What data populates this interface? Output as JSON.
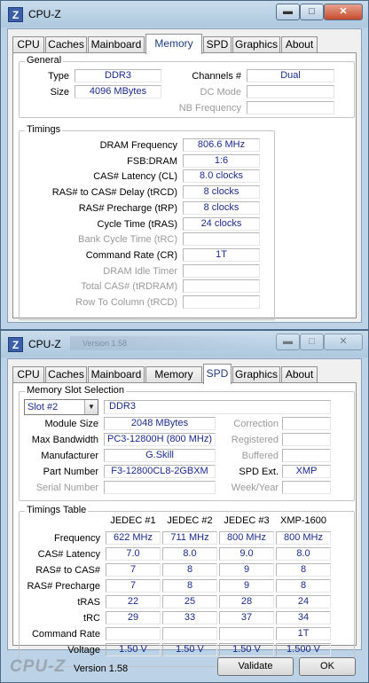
{
  "app_title": "CPU-Z",
  "window2_ghost_title": "Version 1.58",
  "tabs": [
    "CPU",
    "Caches",
    "Mainboard",
    "Memory",
    "SPD",
    "Graphics",
    "About"
  ],
  "memory": {
    "general": {
      "legend": "General",
      "type_label": "Type",
      "type": "DDR3",
      "size_label": "Size",
      "size": "4096 MBytes",
      "channels_label": "Channels #",
      "channels": "Dual",
      "dc_mode_label": "DC Mode",
      "dc_mode": "",
      "nb_freq_label": "NB Frequency",
      "nb_freq": ""
    },
    "timings": {
      "legend": "Timings",
      "rows": [
        {
          "label": "DRAM Frequency",
          "value": "806.6 MHz",
          "enabled": true
        },
        {
          "label": "FSB:DRAM",
          "value": "1:6",
          "enabled": true
        },
        {
          "label": "CAS# Latency (CL)",
          "value": "8.0 clocks",
          "enabled": true
        },
        {
          "label": "RAS# to CAS# Delay (tRCD)",
          "value": "8 clocks",
          "enabled": true
        },
        {
          "label": "RAS# Precharge (tRP)",
          "value": "8 clocks",
          "enabled": true
        },
        {
          "label": "Cycle Time (tRAS)",
          "value": "24 clocks",
          "enabled": true
        },
        {
          "label": "Bank Cycle Time (tRC)",
          "value": "",
          "enabled": false
        },
        {
          "label": "Command Rate (CR)",
          "value": "1T",
          "enabled": true
        },
        {
          "label": "DRAM Idle Timer",
          "value": "",
          "enabled": false
        },
        {
          "label": "Total CAS# (tRDRAM)",
          "value": "",
          "enabled": false
        },
        {
          "label": "Row To Column (tRCD)",
          "value": "",
          "enabled": false
        }
      ]
    }
  },
  "spd": {
    "slot": {
      "legend": "Memory Slot Selection",
      "selected_slot": "Slot #2",
      "type": "DDR3",
      "module_size_label": "Module Size",
      "module_size": "2048 MBytes",
      "max_bw_label": "Max Bandwidth",
      "max_bw": "PC3-12800H (800 MHz)",
      "manufacturer_label": "Manufacturer",
      "manufacturer": "G.Skill",
      "part_label": "Part Number",
      "part": "F3-12800CL8-2GBXM",
      "serial_label": "Serial Number",
      "serial": "",
      "correction_label": "Correction",
      "correction": "",
      "registered_label": "Registered",
      "registered": "",
      "buffered_label": "Buffered",
      "buffered": "",
      "spd_ext_label": "SPD Ext.",
      "spd_ext": "XMP",
      "week_year_label": "Week/Year",
      "week_year": ""
    },
    "timings_table": {
      "legend": "Timings Table",
      "columns": [
        "JEDEC #1",
        "JEDEC #2",
        "JEDEC #3",
        "XMP-1600"
      ],
      "rows": [
        {
          "label": "Frequency",
          "values": [
            "622 MHz",
            "711 MHz",
            "800 MHz",
            "800 MHz"
          ]
        },
        {
          "label": "CAS# Latency",
          "values": [
            "7.0",
            "8.0",
            "9.0",
            "8.0"
          ]
        },
        {
          "label": "RAS# to CAS#",
          "values": [
            "7",
            "8",
            "9",
            "8"
          ]
        },
        {
          "label": "RAS# Precharge",
          "values": [
            "7",
            "8",
            "9",
            "8"
          ]
        },
        {
          "label": "tRAS",
          "values": [
            "22",
            "25",
            "28",
            "24"
          ]
        },
        {
          "label": "tRC",
          "values": [
            "29",
            "33",
            "37",
            "34"
          ]
        },
        {
          "label": "Command Rate",
          "values": [
            "",
            "",
            "",
            "1T"
          ]
        },
        {
          "label": "Voltage",
          "values": [
            "1.50 V",
            "1.50 V",
            "1.50 V",
            "1.500 V"
          ]
        }
      ]
    }
  },
  "footer": {
    "brand": "CPU-Z",
    "version": "Version 1.58",
    "validate": "Validate",
    "ok": "OK"
  }
}
